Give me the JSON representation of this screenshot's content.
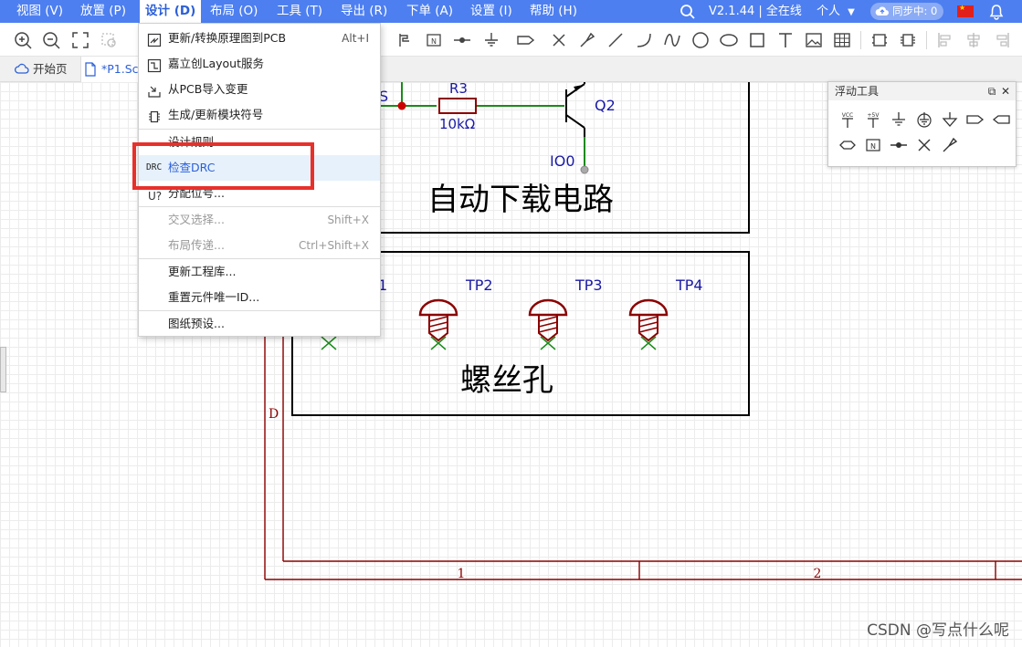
{
  "menubar": {
    "items": [
      "视图 (V)",
      "放置 (P)",
      "设计 (D)",
      "布局 (O)",
      "工具 (T)",
      "导出 (R)",
      "下单 (A)",
      "设置 (I)",
      "帮助 (H)"
    ],
    "version": "V2.1.44 | 全在线",
    "user": "个人",
    "sync": "同步中: 0"
  },
  "tabs": [
    {
      "label": "开始页",
      "icon": "cloud-icon"
    },
    {
      "label": "*P1.Sc",
      "icon": "document-icon"
    }
  ],
  "design_menu": {
    "items": [
      {
        "label": "更新/转换原理图到PCB",
        "shortcut": "Alt+I",
        "disabled": false
      },
      {
        "label": "嘉立创Layout服务",
        "shortcut": "",
        "disabled": false
      },
      {
        "label": "从PCB导入变更",
        "shortcut": "",
        "disabled": false
      },
      {
        "label": "生成/更新模块符号",
        "shortcut": "",
        "disabled": false
      },
      {
        "label": "设计规则...",
        "shortcut": "",
        "disabled": false
      },
      {
        "label": "检查DRC",
        "shortcut": "",
        "disabled": false,
        "icon_text": "DRC"
      },
      {
        "label": "分配位号...",
        "shortcut": "",
        "disabled": false
      },
      {
        "label": "交叉选择...",
        "shortcut": "Shift+X",
        "disabled": true
      },
      {
        "label": "布局传递...",
        "shortcut": "Ctrl+Shift+X",
        "disabled": true
      },
      {
        "label": "更新工程库...",
        "shortcut": "",
        "disabled": false
      },
      {
        "label": "重置元件唯一ID...",
        "shortcut": "",
        "disabled": false
      },
      {
        "label": "图纸预设...",
        "shortcut": "",
        "disabled": false
      }
    ]
  },
  "floating_tools": {
    "title": "浮动工具"
  },
  "schematic": {
    "net_label_s": "S",
    "resistor_ref": "R3",
    "resistor_value": "10kΩ",
    "transistor_ref": "Q2",
    "net_io0": "IO0",
    "block1_title": "自动下载电路",
    "tp1_partial": "1",
    "tp2": "TP2",
    "tp3": "TP3",
    "tp4": "TP4",
    "block2_title": "螺丝孔",
    "frame_row_d": "D",
    "frame_col_1": "1",
    "frame_col_2": "2"
  },
  "watermark": "CSDN @写点什么呢",
  "colors": {
    "menubar": "#4d7ff0",
    "wire": "#1a8a1a",
    "component": "#8b0000",
    "label_blue": "#1a1aa6",
    "frame": "#8b0000",
    "highlight_box": "#e8302b"
  }
}
